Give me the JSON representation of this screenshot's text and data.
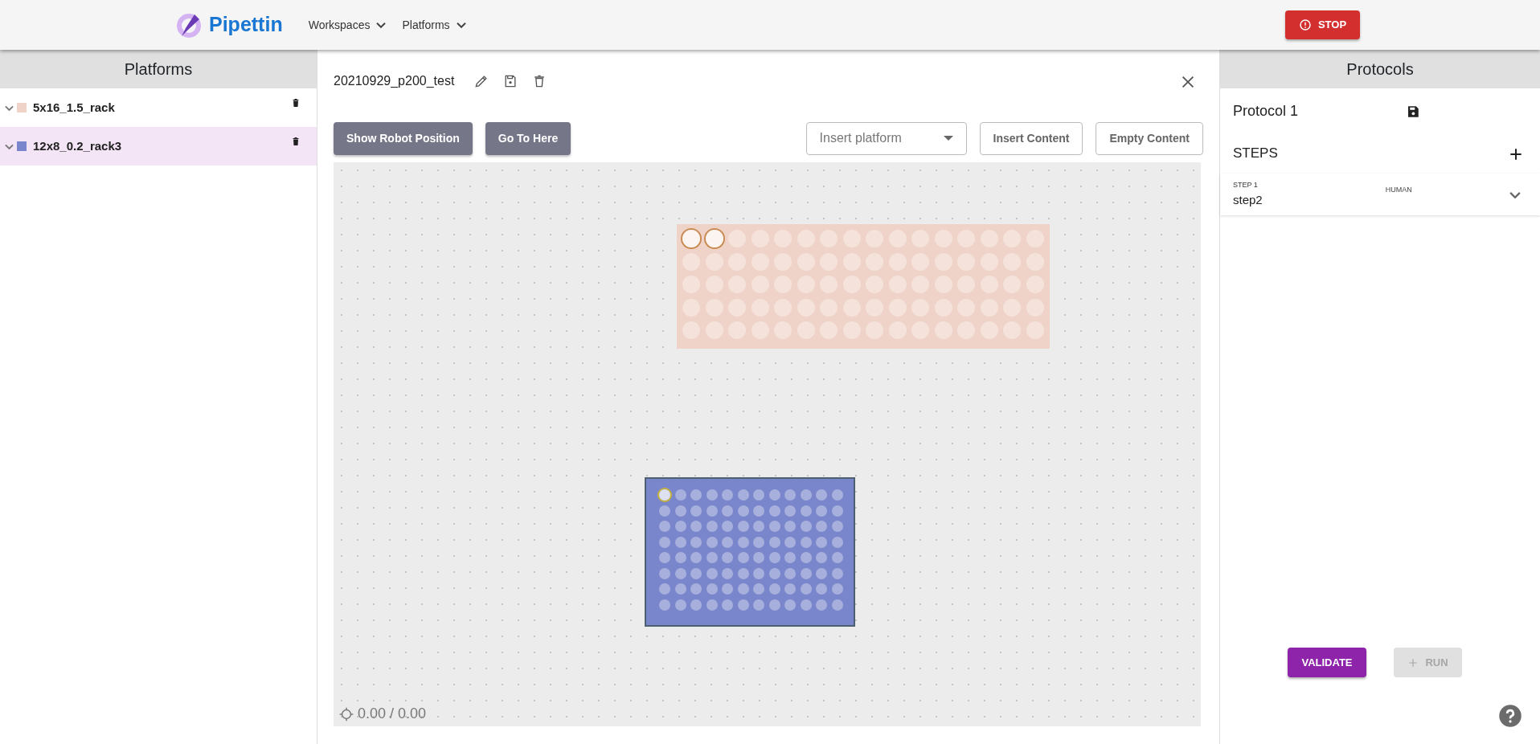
{
  "navbar": {
    "brand": "Pipettin",
    "menus": [
      {
        "label": "Workspaces"
      },
      {
        "label": "Platforms"
      }
    ],
    "stop_button": "STOP"
  },
  "platforms_panel": {
    "title": "Platforms",
    "items": [
      {
        "name": "5x16_1.5_rack",
        "color": "#efd3c8",
        "selected": false
      },
      {
        "name": "12x8_0.2_rack3",
        "color": "#7986cb",
        "selected": true
      }
    ]
  },
  "workspace": {
    "title": "20210929_p200_test",
    "buttons": [
      "Show Robot Position",
      "Go To Here"
    ],
    "insert_platform": {
      "placeholder": "Insert platform"
    },
    "content_buttons": [
      "Insert Content",
      "Empty Content"
    ],
    "canvas": {
      "coordinates": "0.00 / 0.00",
      "racks": [
        {
          "color": "#efd3c8",
          "selected": false,
          "rows": [
            [
              true,
              true,
              false,
              false,
              false,
              false,
              false,
              false,
              false,
              false,
              false,
              false,
              false,
              false,
              false,
              false
            ],
            [
              false,
              false,
              false,
              false,
              false,
              false,
              false,
              false,
              false,
              false,
              false,
              false,
              false,
              false,
              false,
              false
            ],
            [
              false,
              false,
              false,
              false,
              false,
              false,
              false,
              false,
              false,
              false,
              false,
              false,
              false,
              false,
              false,
              false
            ],
            [
              false,
              false,
              false,
              false,
              false,
              false,
              false,
              false,
              false,
              false,
              false,
              false,
              false,
              false,
              false,
              false
            ],
            [
              false,
              false,
              false,
              false,
              false,
              false,
              false,
              false,
              false,
              false,
              false,
              false,
              false,
              false,
              false,
              false
            ]
          ]
        },
        {
          "color": "#7986cb",
          "selected": true,
          "rows": [
            [
              true,
              false,
              false,
              false,
              false,
              false,
              false,
              false,
              false,
              false,
              false,
              false
            ],
            [
              false,
              false,
              false,
              false,
              false,
              false,
              false,
              false,
              false,
              false,
              false,
              false
            ],
            [
              false,
              false,
              false,
              false,
              false,
              false,
              false,
              false,
              false,
              false,
              false,
              false
            ],
            [
              false,
              false,
              false,
              false,
              false,
              false,
              false,
              false,
              false,
              false,
              false,
              false
            ],
            [
              false,
              false,
              false,
              false,
              false,
              false,
              false,
              false,
              false,
              false,
              false,
              false
            ],
            [
              false,
              false,
              false,
              false,
              false,
              false,
              false,
              false,
              false,
              false,
              false,
              false
            ],
            [
              false,
              false,
              false,
              false,
              false,
              false,
              false,
              false,
              false,
              false,
              false,
              false
            ],
            [
              false,
              false,
              false,
              false,
              false,
              false,
              false,
              false,
              false,
              false,
              false,
              false
            ]
          ]
        }
      ]
    }
  },
  "protocols_panel": {
    "title": "Protocols",
    "protocol_name": "Protocol 1",
    "steps_label": "STEPS",
    "steps": [
      {
        "number": "STEP 1",
        "name": "step2",
        "type": "HUMAN"
      }
    ],
    "validate_button": {
      "label": "VALIDATE",
      "disabled": false
    },
    "run_button": {
      "label": "RUN",
      "disabled": true
    }
  }
}
